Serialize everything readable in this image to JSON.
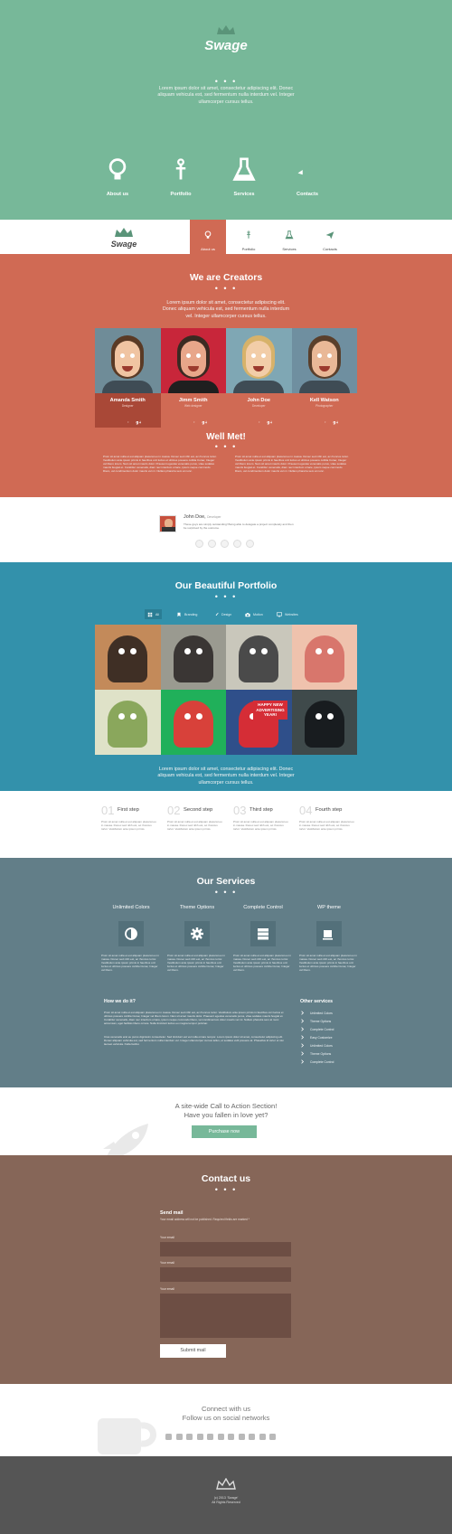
{
  "colors": {
    "green": "#77b899",
    "orange": "#d06a54",
    "blue": "#3391ab",
    "slate": "#627e88",
    "brown": "#866658",
    "footer": "#555555"
  },
  "hero": {
    "logo": "Swage",
    "dots": "• • •",
    "text": "Lorem ipsum dolor sit amet, consectetur adipiscing elit. Donec aliquam vehicula est, sed fermentum nulla interdum vel. Integer ullamcorper cursus tellus.",
    "features": [
      {
        "label": "About us",
        "icon": "lightbulb-icon"
      },
      {
        "label": "Portfolio",
        "icon": "anchor-icon"
      },
      {
        "label": "Services",
        "icon": "flask-icon"
      },
      {
        "label": "Contacts",
        "icon": "rocket-icon"
      }
    ]
  },
  "nav": {
    "logo": "Swage",
    "items": [
      {
        "label": "About us",
        "icon": "lightbulb-icon"
      },
      {
        "label": "Portfolio",
        "icon": "anchor-icon"
      },
      {
        "label": "Services",
        "icon": "flask-icon"
      },
      {
        "label": "Contacts",
        "icon": "plane-icon"
      }
    ]
  },
  "creators": {
    "title": "We are Creators",
    "dots": "• • •",
    "text": "Lorem ipsum dolor sit amet, consectetur adipiscing elit. Donec aliquam vehicula est, sed fermentum nulla interdum vel. Integer ullamcorper cursus tellus.",
    "team": [
      {
        "name": "Amanda Smith",
        "role": "Designer"
      },
      {
        "name": "Jimm Smith",
        "role": "Web designer"
      },
      {
        "name": "John Doe",
        "role": "Developer"
      },
      {
        "name": "Kell Watson",
        "role": "Photographer"
      }
    ],
    "social": [
      "twitter-icon",
      "facebook-icon",
      "google-plus-icon"
    ],
    "meet_title": "Well Met!",
    "meet_dots": "• • •",
    "col1": "Proin sit amet nulla et est aliquam placerat eu in massa. Donec sed nibh est, ac rhoncus tortor. Vestibulum ante ipsum primis in faucibus orci luctus et ultrices posuere cubilia Curae; Integer vel libero lorem. Nam sit amet mauris dolor. Praesent egestas venenatis purus, vitae sodales mauris feugiat et. Curabitur venenatis, diam nec interdum ornare, ipsum neque commodo libero, vel condimentum dolor mauris vel mi. Nullam pharetra sem at nunc.",
    "col2": "Proin sit amet nulla et est aliquam placerat eu in massa. Donec sed nibh est, ac rhoncus tortor. Vestibulum ante ipsum primis in faucibus orci luctus et ultrices posuere cubilia Curae; Integer vel libero lorem. Nam sit amet mauris dolor. Praesent egestas venenatis purus, vitae sodales mauris feugiat et. Curabitur venenatis, diam nec interdum ornare, ipsum neque commodo libero, vel condimentum dolor mauris vel mi. Nullam pharetra sem at nunc."
  },
  "testimonial": {
    "name": "John Doe,",
    "role": "Developer",
    "text": "These guys are simply outstanding! Being able to delegate a project completely and then be surprised by the outcome."
  },
  "portfolio": {
    "title": "Our Beautiful Portfolio",
    "dots": "• • •",
    "filters": [
      {
        "label": "All",
        "icon": "grid-icon"
      },
      {
        "label": "Branding",
        "icon": "bookmark-icon"
      },
      {
        "label": "Design",
        "icon": "brush-icon"
      },
      {
        "label": "Motion",
        "icon": "camera-icon"
      },
      {
        "label": "Websites",
        "icon": "monitor-icon"
      }
    ],
    "tiles": [
      {
        "alt": "alien character",
        "c1": "#c38a5a",
        "c2": "#3f2f25"
      },
      {
        "alt": "fish monster",
        "c1": "#9a9a90",
        "c2": "#3a3634"
      },
      {
        "alt": "raccoon",
        "c1": "#c9c7bb",
        "c2": "#4a4a4a"
      },
      {
        "alt": "pig",
        "c1": "#efc2ad",
        "c2": "#d8766c"
      },
      {
        "alt": "green dragon",
        "c1": "#dfe2c8",
        "c2": "#8aa75c"
      },
      {
        "alt": "red dog",
        "c1": "#20b05a",
        "c2": "#d8413a"
      },
      {
        "alt": "happy new year bird",
        "c1": "#2f4f8a",
        "c2": "#d52d36"
      },
      {
        "alt": "waiters",
        "c1": "#3f4a4b",
        "c2": "#181c1f"
      }
    ],
    "banner": "HAPPY NEW ADVERTISING YEAR!",
    "text": "Lorem ipsum dolor sit amet, consectetur adipiscing elit. Donec aliquam vehicula est, sed fermentum nulla interdum vel. Integer ullamcorper cursus tellus."
  },
  "steps": [
    {
      "num": "01",
      "title": "First step",
      "text": "Proin sit amet nulla et est aliquam placerat eu in massa. Donec sed nibh est, ac rhoncus tortor. Vestibulum ante ipsum primis."
    },
    {
      "num": "02",
      "title": "Second step",
      "text": "Proin sit amet nulla et est aliquam placerat eu in massa. Donec sed nibh est, ac rhoncus tortor. Vestibulum ante ipsum primis."
    },
    {
      "num": "03",
      "title": "Third step",
      "text": "Proin sit amet nulla et est aliquam placerat eu in massa. Donec sed nibh est, ac rhoncus tortor. Vestibulum ante ipsum primis."
    },
    {
      "num": "04",
      "title": "Fourth step",
      "text": "Proin sit amet nulla et est aliquam placerat eu in massa. Donec sed nibh est, ac rhoncus tortor. Vestibulum ante ipsum primis."
    }
  ],
  "services": {
    "title": "Our Services",
    "dots": "• • •",
    "items": [
      {
        "title": "Unlimited Colors",
        "icon": "contrast-icon",
        "text": "Proin sit amet nulla et est aliquam placerat eu in massa. Donec sed nibh est, ac rhoncus tortor. Vestibulum ante ipsum primis in faucibus orci luctus et ultrices posuere cubilia Curae; Integer vel libero."
      },
      {
        "title": "Theme Options",
        "icon": "gear-icon",
        "text": "Proin sit amet nulla et est aliquam placerat eu in massa. Donec sed nibh est, ac rhoncus tortor. Vestibulum ante ipsum primis in faucibus orci luctus et ultrices posuere cubilia Curae; Integer vel libero."
      },
      {
        "title": "Complete Control",
        "icon": "server-icon",
        "text": "Proin sit amet nulla et est aliquam placerat eu in massa. Donec sed nibh est, ac rhoncus tortor. Vestibulum ante ipsum primis in faucibus orci luctus et ultrices posuere cubilia Curae; Integer vel libero."
      },
      {
        "title": "WP theme",
        "icon": "cup-icon",
        "text": "Proin sit amet nulla et est aliquam placerat eu in massa. Donec sed nibh est, ac rhoncus tortor. Vestibulum ante ipsum primis in faucibus orci luctus et ultrices posuere cubilia Curae; Integer vel libero."
      }
    ],
    "how_title": "How we do it?",
    "how_p1": "Proin sit amet nulla et est aliquam placerat eu in massa. Donec sed nibh est, ac rhoncus tortor. Vestibulum ante ipsum primis in faucibus orci luctus et ultrices posuere cubilia Curae; Integer vel libero lorem. Nam sit amet mauris dolor. Praesent egestas venenatis purus, vitae sodales mauris feugiat et. Curabitur venenatis, diam nec interdum ornare, ipsum neque commodo libero, vel condimentum dolor mauris vel mi. Nullam pharetra sem at nunc accumsan, eget facilisis libero ornare. Nulla tincidunt lectus eu magna tempor pulvinar.",
    "how_p2": "Cras venenatis erat eu purus dignissim consectetur. Sed tincidunt est vel nulla ornare tempor. Lorem ipsum dolor sit amet, consectetur adipiscing elit. Donec aliquam vehicula est, sed fermentum nulla interdum vel. Integer ullamcorper cursus tellus, et sodales velit posuere at. Phasellus id tortor ut nisi laoreet vehicula. Nulla facilisi.",
    "other_title": "Other services",
    "other": [
      "Unlimited Colors",
      "Theme Options",
      "Complete Control",
      "Easy Customize",
      "Unlimited Colors",
      "Theme Options",
      "Complete Control"
    ]
  },
  "cta": {
    "line1": "A site-wide Call to Action Section!",
    "line2": "Have you fallen in love yet?",
    "button": "Purchase now"
  },
  "contact": {
    "title": "Contact us",
    "dots": "• • •",
    "form_title": "Send mail",
    "form_note": "Your email address will not be published. Required fields are marked *",
    "label1": "Your email",
    "label2": "Your email",
    "label3": "Your email",
    "submit": "Submit mail"
  },
  "social": {
    "line1": "Connect with us",
    "line2": "Follow us on social networks",
    "icons": [
      "skype-icon",
      "twitter-icon",
      "digg-icon",
      "blogger-icon",
      "facebook-icon",
      "google-plus-icon",
      "vimeo-icon",
      "lastfm-icon",
      "rss-icon",
      "linkedin-icon",
      "myspace-icon"
    ]
  },
  "footer": {
    "line1": "(c) 2013 'Swage'",
    "line2": "All Rights Reserved"
  }
}
